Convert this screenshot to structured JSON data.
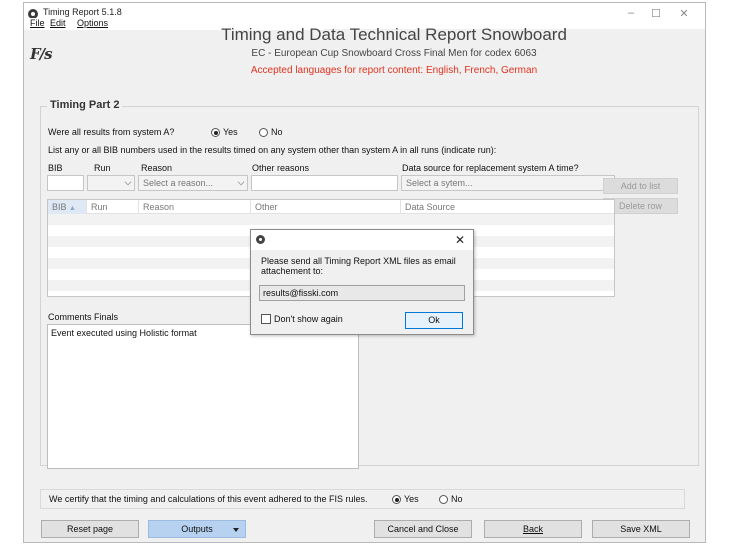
{
  "window": {
    "title": "Timing Report 5.1.8",
    "minimize": "–",
    "maximize": "☐",
    "close": "✕"
  },
  "menu": {
    "file": "File",
    "edit": "Edit",
    "options": "Options"
  },
  "header": {
    "logo": "F/s",
    "title": "Timing and Data Technical Report Snowboard",
    "subtitle": "EC - European Cup Snowboard Cross Final Men for codex 6063",
    "languages": "Accepted languages for report content: English, French, German"
  },
  "timing": {
    "section_title": "Timing Part 2",
    "question": "Were all results from system A?",
    "yes": "Yes",
    "no": "No",
    "selected": "yes",
    "instruction": "List any or all BIB numbers used in the results timed on any system other than system A in all runs (indicate run):",
    "labels": {
      "bib": "BIB",
      "run": "Run",
      "reason": "Reason",
      "other": "Other reasons",
      "datasource": "Data source for replacement system A time?"
    },
    "reason_placeholder": "Select a reason...",
    "datasource_placeholder": "Select a sytem...",
    "add_button": "Add to list",
    "delete_button": "Delete row"
  },
  "table": {
    "columns": [
      "BIB",
      "Run",
      "Reason",
      "Other",
      "Data Source"
    ],
    "sort_icon": "▲"
  },
  "comments": {
    "label": "Comments Finals",
    "value": "Event executed using Holistic format"
  },
  "certify": {
    "text": "We certify that the timing and calculations of this event adhered to the FIS rules.",
    "yes": "Yes",
    "no": "No",
    "selected": "yes"
  },
  "buttons": {
    "reset": "Reset page",
    "outputs": "Outputs",
    "cancel": "Cancel and Close",
    "back": "Back",
    "save": "Save XML"
  },
  "dialog": {
    "message": "Please send all Timing Report XML files as email attachement to:",
    "email": "results@fisski.com",
    "checkbox": "Don't show again",
    "ok": "Ok",
    "close": "✕"
  }
}
